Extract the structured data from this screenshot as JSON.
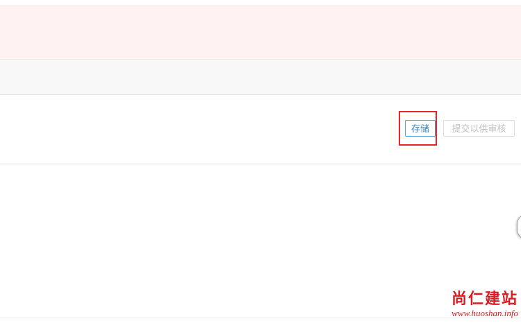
{
  "actions": {
    "save_label": "存储",
    "submit_label": "提交以供审核"
  },
  "watermark": {
    "title": "尚仁建站",
    "url": "www.huoshan.info"
  },
  "colors": {
    "highlight": "#e8262a",
    "primary": "#2f86cf",
    "alert_background": "#fff3f1",
    "watermark": "#d81e24"
  }
}
